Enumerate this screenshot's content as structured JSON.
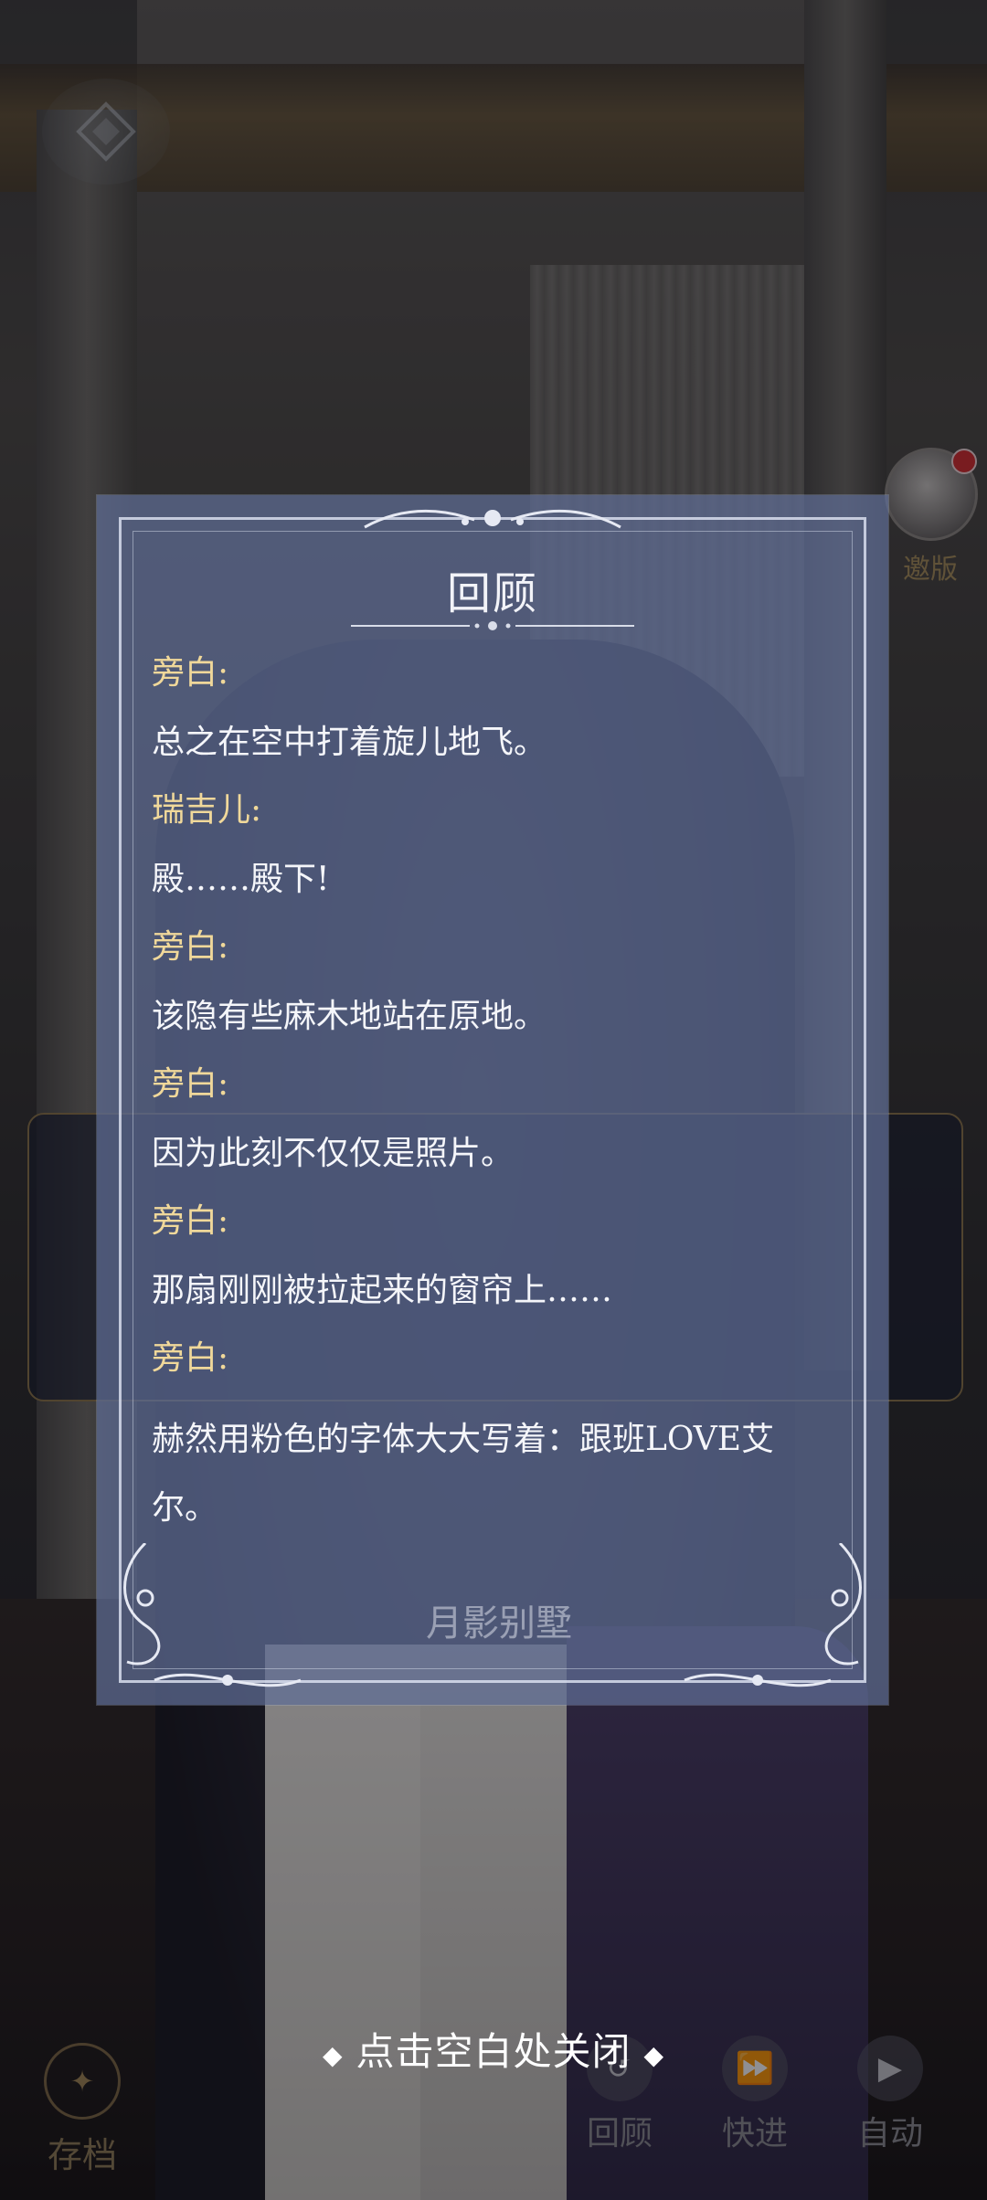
{
  "review": {
    "title": "回顾",
    "entries": [
      {
        "speaker": "旁白:",
        "text": "总之在空中打着旋儿地飞。"
      },
      {
        "speaker": "瑞吉儿:",
        "text": "殿……殿下!"
      },
      {
        "speaker": "旁白:",
        "text": "该隐有些麻木地站在原地。"
      },
      {
        "speaker": "旁白:",
        "text": "因为此刻不仅仅是照片。"
      },
      {
        "speaker": "旁白:",
        "text": "那扇刚刚被拉起来的窗帘上……"
      },
      {
        "speaker": "旁白:",
        "text": "赫然用粉色的字体大大写着：跟班LOVE艾尔。"
      }
    ],
    "watermark": "月影别墅"
  },
  "close_hint": "点击空白处关闭",
  "side": {
    "avatar_label": "邀版"
  },
  "controls": {
    "save": "存档",
    "review": "回顾",
    "fast_forward": "快进",
    "auto": "自动"
  },
  "colors": {
    "panel_bg": "#606e96",
    "speaker": "#f0d89a",
    "text": "#f5f6fa",
    "notification": "#d42b2b"
  }
}
